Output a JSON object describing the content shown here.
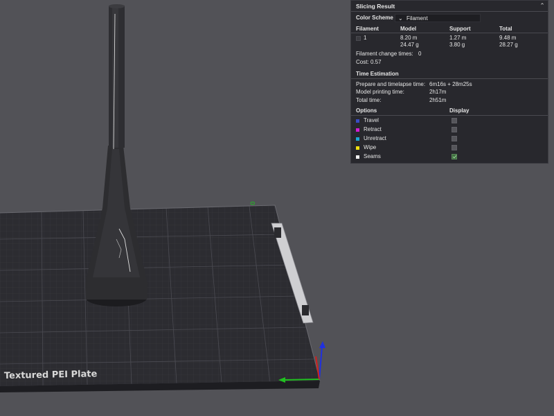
{
  "scene": {
    "plate_label": "Textured PEI Plate",
    "plate_corner_label": "0"
  },
  "panel": {
    "title": "Slicing Result",
    "color_scheme_label": "Color Scheme",
    "color_scheme_value": "Filament",
    "filament_table": {
      "headers": [
        "Filament",
        "Model",
        "Support",
        "Total"
      ],
      "row": {
        "id": "1",
        "model_length": "8.20 m",
        "model_weight": "24.47 g",
        "support_length": "1.27 m",
        "support_weight": "3.80 g",
        "total_length": "9.48 m",
        "total_weight": "28.27 g"
      }
    },
    "filament_change_label": "Filament change times:",
    "filament_change_value": "0",
    "cost_label": "Cost:",
    "cost_value": "0.57",
    "time_estimation_title": "Time Estimation",
    "time_rows": [
      {
        "label": "Prepare and timelapse time:",
        "value": "6m16s + 28m25s"
      },
      {
        "label": "Model printing time:",
        "value": "2h17m"
      },
      {
        "label": "Total time:",
        "value": "2h51m"
      }
    ],
    "options_header": "Options",
    "display_header": "Display",
    "options": [
      {
        "label": "Travel",
        "color": "#3a4cc4",
        "checked": false
      },
      {
        "label": "Retract",
        "color": "#d41ad4",
        "checked": false
      },
      {
        "label": "Unretract",
        "color": "#1aa6d4",
        "checked": false
      },
      {
        "label": "Wipe",
        "color": "#f0e010",
        "checked": false
      },
      {
        "label": "Seams",
        "color": "#f0f0f0",
        "checked": true
      }
    ]
  }
}
